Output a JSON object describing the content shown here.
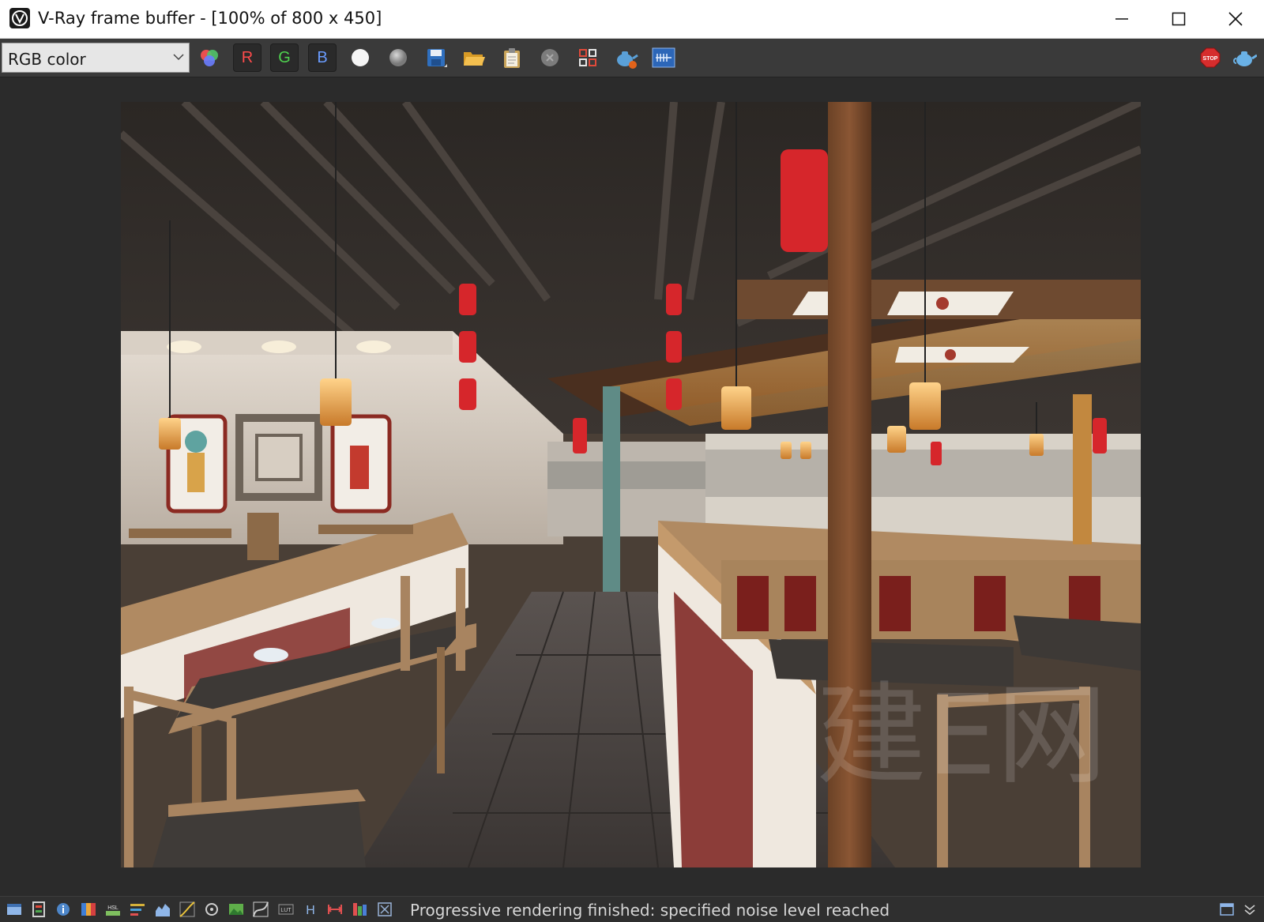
{
  "window": {
    "title": "V-Ray frame buffer - [100% of 800 x 450]"
  },
  "toolbar": {
    "channel_select": "RGB color",
    "channels": {
      "r": "R",
      "g": "G",
      "b": "B"
    },
    "buttons": [
      "color-channels-icon",
      "mono-white-icon",
      "mono-gray-icon",
      "save-icon",
      "open-icon",
      "clipboard-icon",
      "clear-icon",
      "region-render-icon",
      "render-last-icon",
      "lens-effects-icon",
      "stop-render-icon",
      "render-teapot-icon"
    ],
    "stop_label": "STOP"
  },
  "status": {
    "message": "Progressive rendering finished: specified noise level reached",
    "icons": [
      "show-history-icon",
      "correction-control-icon",
      "info-icon",
      "color-gradient-icon",
      "hsl-icon",
      "levels-icon",
      "histogram-icon",
      "curves-icon",
      "exposure-icon",
      "background-icon",
      "curve-icon",
      "lut-icon",
      "h-icon",
      "horizontal-fit-icon",
      "rgb-bars-icon",
      "pixel-info-icon"
    ],
    "hsl_label": "HSL",
    "lut_label": "LUT",
    "h_label": "H"
  },
  "colors": {
    "titlebar": "#ffffff",
    "toolbar": "#3a3a3a",
    "workspace": "#2b2b2b",
    "channel_red": "#ff4b4b",
    "channel_green": "#4fd24f",
    "channel_blue": "#6a9cff"
  },
  "render_image": {
    "wall_text": "建E网"
  }
}
